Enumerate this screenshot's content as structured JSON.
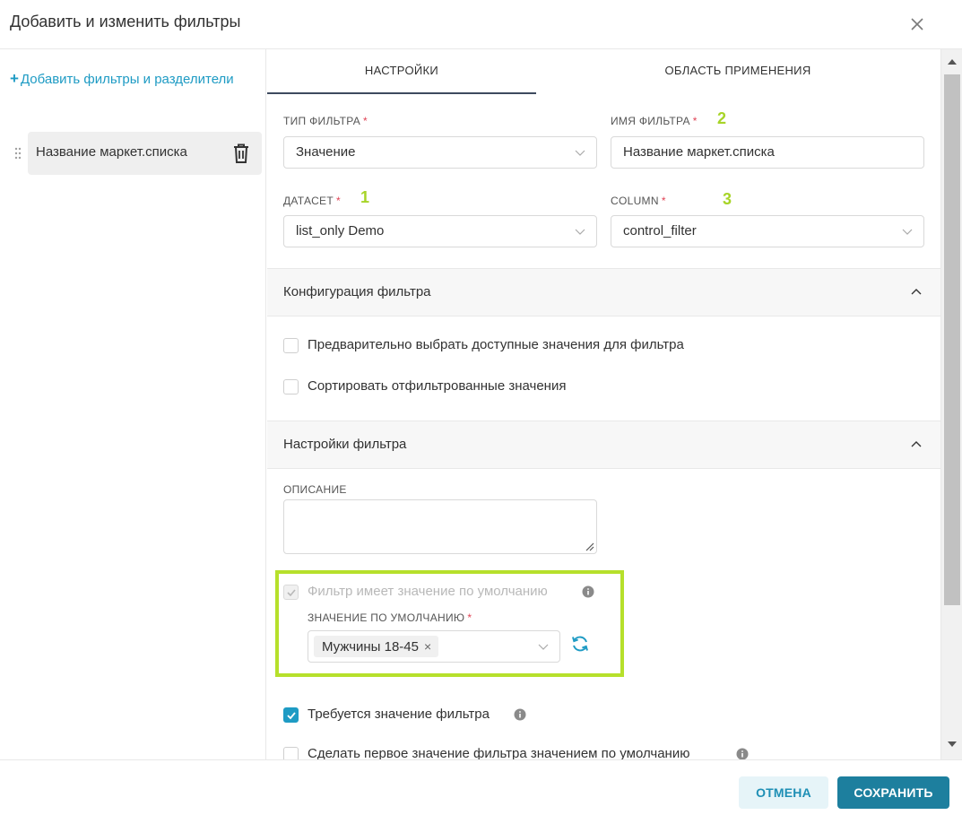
{
  "modal": {
    "title": "Добавить и изменить фильтры"
  },
  "sidebar": {
    "add_link_icon": "+",
    "add_link_text": "Добавить фильтры и разделители",
    "items": [
      {
        "label": "Название маркет.списка"
      }
    ]
  },
  "tabs": [
    {
      "label": "НАСТРОЙКИ",
      "active": true
    },
    {
      "label": "ОБЛАСТЬ ПРИМЕНЕНИЯ",
      "active": false
    }
  ],
  "fields": {
    "filter_type": {
      "label": "ТИП ФИЛЬТРА",
      "required": "*",
      "value": "Значение"
    },
    "filter_name": {
      "label": "ИМЯ ФИЛЬТРА",
      "required": "*",
      "value": "Название маркет.списка",
      "marker": "2"
    },
    "dataset": {
      "label": "ДАТАСЕТ",
      "required": "*",
      "value": "list_only Demo",
      "marker": "1"
    },
    "column": {
      "label": "COLUMN",
      "required": "*",
      "value": "control_filter",
      "marker": "3"
    }
  },
  "section_config": {
    "title": "Конфигурация фильтра",
    "options": [
      {
        "label": "Предварительно выбрать доступные значения для фильтра",
        "checked": false
      },
      {
        "label": "Сортировать отфильтрованные значения",
        "checked": false
      }
    ]
  },
  "section_settings": {
    "title": "Настройки фильтра",
    "description_label": "ОПИСАНИЕ",
    "description_value": "",
    "default_checkbox_label": "Фильтр имеет значение по умолчанию",
    "default_value_label": "ЗНАЧЕНИЕ ПО УМОЛЧАНИЮ",
    "default_value_required": "*",
    "default_value_tag": "Мужчины 18-45",
    "tag_remove": "×",
    "required_label": "Требуется значение фильтра",
    "first_default_label": "Сделать первое значение фильтра значением по умолчанию"
  },
  "footer": {
    "cancel": "ОТМЕНА",
    "save": "СОХРАНИТЬ"
  },
  "colors": {
    "accent": "#1e9bc4",
    "save_button": "#1d7f9e",
    "highlight": "#b6e02b",
    "required": "#e04355"
  }
}
